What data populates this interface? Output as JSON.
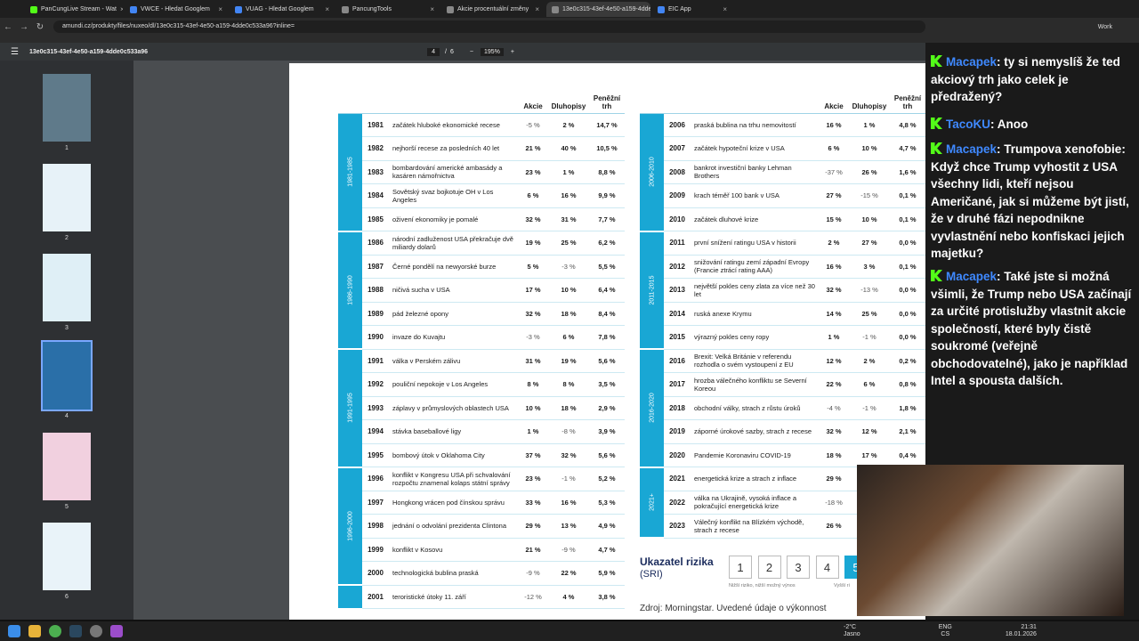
{
  "browser": {
    "tabs": [
      {
        "label": "PanCungLive Stream - Wat",
        "color": "#53fc18",
        "active": false
      },
      {
        "label": "VWCE - Hledat Googlem",
        "color": "#4285f4",
        "active": false
      },
      {
        "label": "VUAG - Hledat Googlem",
        "color": "#4285f4",
        "active": false
      },
      {
        "label": "PancungTools",
        "color": "#888888",
        "active": false
      },
      {
        "label": "Akcie procentuální změny",
        "color": "#888888",
        "active": false
      },
      {
        "label": "13e0c315-43ef-4e50-a159-4dde",
        "color": "#888888",
        "active": true
      },
      {
        "label": "EIC App",
        "color": "#4285f4",
        "active": false
      }
    ],
    "url": "amundi.cz/produkty/files/nuxeo/dl/13e0c315-43ef-4e50-a159-4dde0c533a96?inline=",
    "profile": "Work"
  },
  "pdf": {
    "filename": "13e0c315-43ef-4e50-a159-4dde0c533a96",
    "page_current": "4",
    "page_total": "6",
    "zoom": "195%"
  },
  "thumbs": [
    "1",
    "2",
    "3",
    "4",
    "5",
    "6"
  ],
  "table_headers": {
    "stocks": "Akcie",
    "bonds": "Dluhopisy",
    "money": "Peněžní trh"
  },
  "left_table": [
    {
      "band": "1981-1985",
      "rows": [
        [
          "1981",
          "začátek hluboké ekonomické recese",
          "-5 %",
          "2 %",
          "14,7 %"
        ],
        [
          "1982",
          "nejhorší recese za posledních 40 let",
          "21 %",
          "40 %",
          "10,5 %"
        ],
        [
          "1983",
          "bombardování americké ambasády a kasáren námořnictva",
          "23 %",
          "1 %",
          "8,8 %"
        ],
        [
          "1984",
          "Sovětský svaz bojkotuje OH v Los Angeles",
          "6 %",
          "16 %",
          "9,9 %"
        ],
        [
          "1985",
          "oživení ekonomiky je pomalé",
          "32 %",
          "31 %",
          "7,7 %"
        ]
      ]
    },
    {
      "band": "1986-1990",
      "rows": [
        [
          "1986",
          "národní zadluženost USA překračuje dvě miliardy dolarů",
          "19 %",
          "25 %",
          "6,2 %"
        ],
        [
          "1987",
          "Černé pondělí na newyorské burze",
          "5 %",
          "-3 %",
          "5,5 %"
        ],
        [
          "1988",
          "ničivá sucha v USA",
          "17 %",
          "10 %",
          "6,4 %"
        ],
        [
          "1989",
          "pád železné opony",
          "32 %",
          "18 %",
          "8,4 %"
        ],
        [
          "1990",
          "invaze do Kuvajtu",
          "-3 %",
          "6 %",
          "7,8 %"
        ]
      ]
    },
    {
      "band": "1991-1995",
      "rows": [
        [
          "1991",
          "válka v Perském zálivu",
          "31 %",
          "19 %",
          "5,6 %"
        ],
        [
          "1992",
          "pouliční nepokoje v Los Angeles",
          "8 %",
          "8 %",
          "3,5 %"
        ],
        [
          "1993",
          "záplavy v průmyslových oblastech USA",
          "10 %",
          "18 %",
          "2,9 %"
        ],
        [
          "1994",
          "stávka baseballové ligy",
          "1 %",
          "-8 %",
          "3,9 %"
        ],
        [
          "1995",
          "bombový útok v Oklahoma City",
          "37 %",
          "32 %",
          "5,6 %"
        ]
      ]
    },
    {
      "band": "1996-2000",
      "rows": [
        [
          "1996",
          "konflikt v Kongresu USA při schvalování rozpočtu znamenal kolaps státní správy",
          "23 %",
          "-1 %",
          "5,2 %"
        ],
        [
          "1997",
          "Hongkong vrácen pod čínskou správu",
          "33 %",
          "16 %",
          "5,3 %"
        ],
        [
          "1998",
          "jednání o odvolání prezidenta Clintona",
          "29 %",
          "13 %",
          "4,9 %"
        ],
        [
          "1999",
          "konflikt v Kosovu",
          "21 %",
          "-9 %",
          "4,7 %"
        ],
        [
          "2000",
          "technologická bublina praská",
          "-9 %",
          "22 %",
          "5,9 %"
        ]
      ]
    },
    {
      "band": "",
      "rows": [
        [
          "2001",
          "teroristické útoky 11. září",
          "-12 %",
          "4 %",
          "3,8 %"
        ]
      ]
    }
  ],
  "right_table": [
    {
      "band": "2006-2010",
      "rows": [
        [
          "2006",
          "praská bublina na trhu nemovitostí",
          "16 %",
          "1 %",
          "4,8 %"
        ],
        [
          "2007",
          "začátek hypoteční krize v USA",
          "6 %",
          "10 %",
          "4,7 %"
        ],
        [
          "2008",
          "bankrot investiční banky Lehman Brothers",
          "-37 %",
          "26 %",
          "1,6 %"
        ],
        [
          "2009",
          "krach téměř 100 bank v USA",
          "27 %",
          "-15 %",
          "0,1 %"
        ],
        [
          "2010",
          "začátek dluhové krize",
          "15 %",
          "10 %",
          "0,1 %"
        ]
      ]
    },
    {
      "band": "2011-2015",
      "rows": [
        [
          "2011",
          "první snížení ratingu USA v historii",
          "2 %",
          "27 %",
          "0,0 %"
        ],
        [
          "2012",
          "snižování ratingu zemí západní Evropy (Francie ztrácí rating AAA)",
          "16 %",
          "3 %",
          "0,1 %"
        ],
        [
          "2013",
          "největší pokles ceny zlata za více než 30 let",
          "32 %",
          "-13 %",
          "0,0 %"
        ],
        [
          "2014",
          "ruská anexe Krymu",
          "14 %",
          "25 %",
          "0,0 %"
        ],
        [
          "2015",
          "výrazný pokles ceny ropy",
          "1 %",
          "-1 %",
          "0,0 %"
        ]
      ]
    },
    {
      "band": "2016-2020",
      "rows": [
        [
          "2016",
          "Brexit: Velká Británie v referendu rozhodla o svém vystoupení z EU",
          "12 %",
          "2 %",
          "0,2 %"
        ],
        [
          "2017",
          "hrozba válečného konfliktu se Severní Koreou",
          "22 %",
          "6 %",
          "0,8 %"
        ],
        [
          "2018",
          "obchodní války, strach z růstu úroků",
          "-4 %",
          "-1 %",
          "1,8 %"
        ],
        [
          "2019",
          "záporné úrokové sazby, strach z recese",
          "32 %",
          "12 %",
          "2,1 %"
        ],
        [
          "2020",
          "Pandemie Koronaviru COVID-19",
          "18 %",
          "17 %",
          "0,4 %"
        ]
      ]
    },
    {
      "band": "2021+",
      "rows": [
        [
          "2021",
          "energetická krize a strach z inflace",
          "29 %",
          "",
          ""
        ],
        [
          "2022",
          "válka na Ukrajině, vysoká inflace a pokračující energetická krize",
          "-18 %",
          "",
          ""
        ],
        [
          "2023",
          "Válečný konflikt na Blízkém východě, strach z recese",
          "26 %",
          "",
          ""
        ]
      ]
    }
  ],
  "risk": {
    "title": "Ukazatel rizika",
    "subtitle": "(SRI)",
    "levels": [
      "1",
      "2",
      "3",
      "4",
      "5"
    ],
    "low_label": "Nižší riziko, nižší možný výnos",
    "high_label": "Vyšší ri",
    "source": "Zdroj: Morningstar. Uvedené údaje o výkonnost"
  },
  "chat": [
    {
      "user": "Macapek",
      "text": "ty si nemyslíš že ted akciový trh jako celek je předražený?"
    },
    {
      "user": "TacoKU",
      "text": "Anoo"
    },
    {
      "user": "Macapek",
      "text": "Trumpova xenofobie: Když chce Trump vyhostit z USA všechny lidi, kteří nejsou Američané, jak si můžeme být jistí, že v druhé fázi nepodnikne vyvlastnění nebo konfiskaci jejich majetku?"
    },
    {
      "user": "Macapek",
      "text": "Také jste si možná všimli, že Trump nebo USA začínají za určité protislužby vlastnit akcie společností, které byly čistě soukromé (veřejně obchodovatelné), jako je například Intel a spousta dalších."
    }
  ],
  "taskbar": {
    "weather": "-2°C",
    "weather_label": "Jasno",
    "lang": "ENG",
    "lang2": "CS",
    "time": "21:31",
    "date": "18.01.2026"
  }
}
